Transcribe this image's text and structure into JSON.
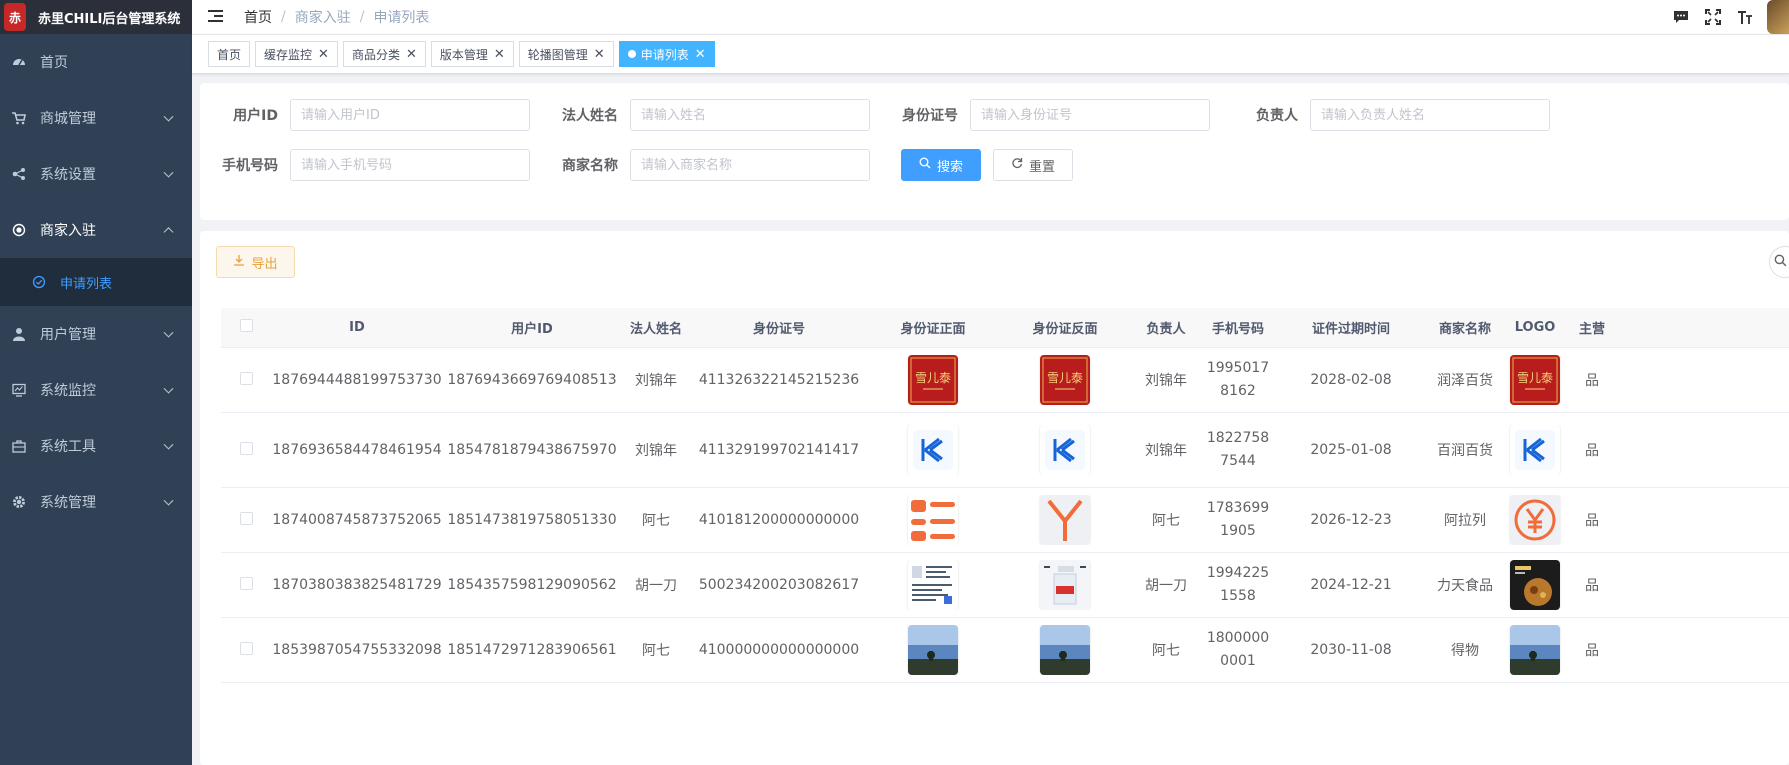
{
  "app_title": "赤里CHILI后台管理系统",
  "logo_glyph": "赤",
  "sidebar": {
    "items": [
      {
        "label": "首页",
        "icon": "dashboard-icon"
      },
      {
        "label": "商城管理",
        "icon": "cart-icon"
      },
      {
        "label": "系统设置",
        "icon": "share-icon"
      },
      {
        "label": "商家入驻",
        "icon": "radio-icon"
      },
      {
        "label": "用户管理",
        "icon": "user-icon"
      },
      {
        "label": "系统监控",
        "icon": "monitor-icon"
      },
      {
        "label": "系统工具",
        "icon": "toolbox-icon"
      },
      {
        "label": "系统管理",
        "icon": "gear-icon"
      }
    ],
    "sub_item": {
      "label": "申请列表",
      "icon": "check-circle-icon"
    }
  },
  "breadcrumb": {
    "home": "首页",
    "level1": "商家入驻",
    "level2": "申请列表",
    "sep": "/"
  },
  "tags": [
    {
      "label": "首页",
      "closable": false
    },
    {
      "label": "缓存监控",
      "closable": true
    },
    {
      "label": "商品分类",
      "closable": true
    },
    {
      "label": "版本管理",
      "closable": true
    },
    {
      "label": "轮播图管理",
      "closable": true
    },
    {
      "label": "申请列表",
      "closable": true,
      "active": true
    }
  ],
  "search": {
    "user_id": {
      "label": "用户ID",
      "placeholder": "请输入用户ID"
    },
    "legal_name": {
      "label": "法人姓名",
      "placeholder": "请输入姓名"
    },
    "id_number": {
      "label": "身份证号",
      "placeholder": "请输入身份证号"
    },
    "manager": {
      "label": "负责人",
      "placeholder": "请输入负责人姓名"
    },
    "phone": {
      "label": "手机号码",
      "placeholder": "请输入手机号码"
    },
    "shop_name": {
      "label": "商家名称",
      "placeholder": "请输入商家名称"
    },
    "search_btn": "搜索",
    "reset_btn": "重置"
  },
  "toolbar": {
    "export_label": "导出"
  },
  "table": {
    "headers": [
      "ID",
      "用户ID",
      "法人姓名",
      "身份证号",
      "身份证正面",
      "身份证反面",
      "负责人",
      "手机号码",
      "证件过期时间",
      "商家名称",
      "LOGO",
      "主营"
    ],
    "rows": [
      {
        "id": "1876944488199753730",
        "user_id": "1876943669769408513",
        "legal_name": "刘锦年",
        "id_number": "411326322145215236",
        "front": "snow-brand",
        "back": "snow-brand",
        "manager": "刘锦年",
        "phone1": "1995017",
        "phone2": "8162",
        "expire": "2028-02-08",
        "shop": "润泽百货",
        "logo": "snow-brand",
        "main": "品"
      },
      {
        "id": "1876936584478461954",
        "user_id": "1854781879438675970",
        "legal_name": "刘锦年",
        "id_number": "411329199702141417",
        "front": "k-logo",
        "back": "k-logo",
        "manager": "刘锦年",
        "phone1": "1822758",
        "phone2": "7544",
        "expire": "2025-01-08",
        "shop": "百润百货",
        "logo": "k-logo",
        "main": "品"
      },
      {
        "id": "1874008745873752065",
        "user_id": "1851473819758051330",
        "legal_name": "阿七",
        "id_number": "410181200000000000",
        "front": "list-orange",
        "back": "y-orange",
        "manager": "阿七",
        "phone1": "1783699",
        "phone2": "1905",
        "expire": "2026-12-23",
        "shop": "阿拉列",
        "logo": "yen-orange",
        "main": "品"
      },
      {
        "id": "1870380383825481729",
        "user_id": "1854357598129090562",
        "legal_name": "胡一刀",
        "id_number": "500234200203082617",
        "front": "doc-scan",
        "back": "bottle-photo",
        "manager": "胡一刀",
        "phone1": "1994225",
        "phone2": "1558",
        "expire": "2024-12-21",
        "shop": "力天食品",
        "logo": "food-dark",
        "main": "品"
      },
      {
        "id": "1853987054755332098",
        "user_id": "1851472971283906561",
        "legal_name": "阿七",
        "id_number": "410000000000000000",
        "front": "sea-photo",
        "back": "sea-photo",
        "manager": "阿七",
        "phone1": "1800000",
        "phone2": "0001",
        "expire": "2030-11-08",
        "shop": "得物",
        "logo": "sea-photo",
        "main": "品"
      }
    ]
  }
}
